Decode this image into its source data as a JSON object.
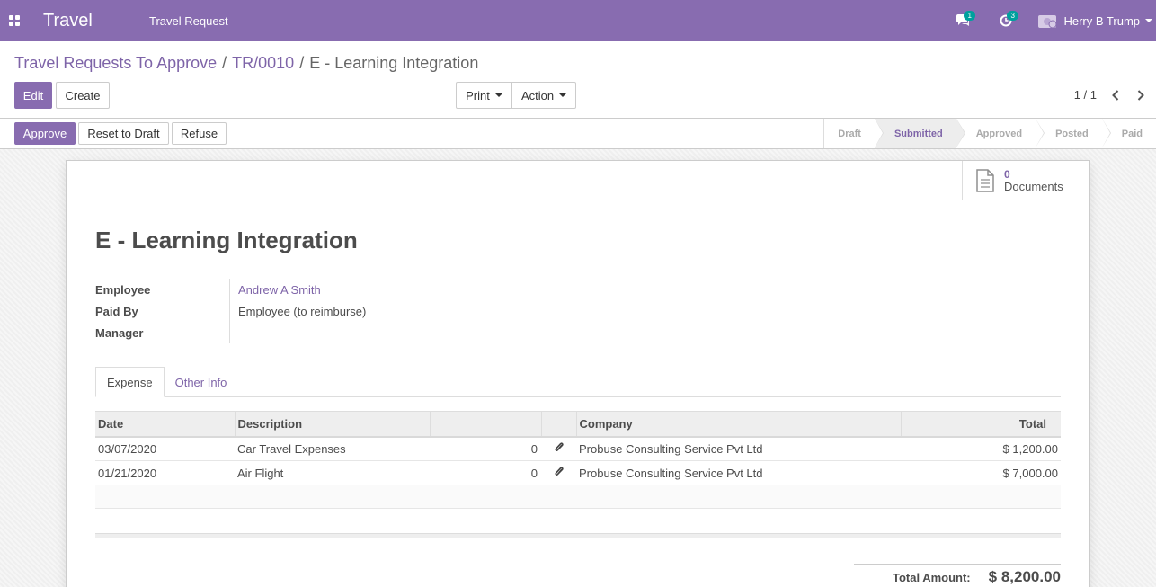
{
  "navbar": {
    "brand": "Travel",
    "menu_item": "Travel Request",
    "chat_badge": "1",
    "activity_badge": "3",
    "user_name": "Herry B Trump"
  },
  "breadcrumb": {
    "item1": "Travel Requests To Approve",
    "item2": "TR/0010",
    "current": "E - Learning Integration"
  },
  "control": {
    "edit_label": "Edit",
    "create_label": "Create",
    "print_label": "Print",
    "action_label": "Action",
    "pager": "1 / 1"
  },
  "statusbar": {
    "approve_label": "Approve",
    "reset_label": "Reset to Draft",
    "refuse_label": "Refuse",
    "stages": [
      "Draft",
      "Submitted",
      "Approved",
      "Posted",
      "Paid"
    ],
    "active_stage": "Submitted"
  },
  "documents": {
    "count": "0",
    "label": "Documents"
  },
  "form": {
    "title": "E - Learning Integration",
    "employee_label": "Employee",
    "employee_value": "Andrew A Smith",
    "paid_by_label": "Paid By",
    "paid_by_value": "Employee (to reimburse)",
    "manager_label": "Manager",
    "manager_value": ""
  },
  "tabs": [
    "Expense",
    "Other Info"
  ],
  "table": {
    "headers": [
      "Date",
      "Description",
      "",
      "",
      "Company",
      "Total"
    ],
    "rows": [
      {
        "date": "03/07/2020",
        "description": "Car Travel Expenses",
        "attachments": "0",
        "company": "Probuse Consulting Service Pvt Ltd",
        "total": "$ 1,200.00"
      },
      {
        "date": "01/21/2020",
        "description": "Air Flight",
        "attachments": "0",
        "company": "Probuse Consulting Service Pvt Ltd",
        "total": "$ 7,000.00"
      }
    ]
  },
  "total": {
    "label": "Total Amount:",
    "value": "$ 8,200.00"
  },
  "colors": {
    "primary": "#886cb0",
    "link": "#7e64a8",
    "badge": "#00a09d"
  }
}
